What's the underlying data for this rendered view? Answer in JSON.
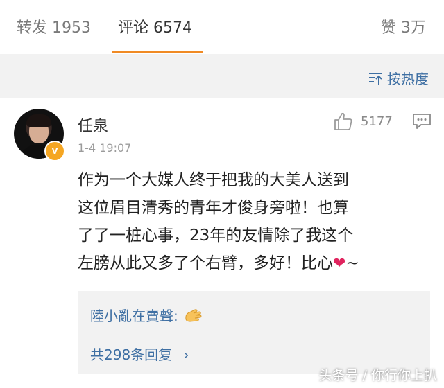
{
  "tabs": {
    "repost": "转发 1953",
    "comments": "评论 6574",
    "likes": "赞 3万"
  },
  "sort": {
    "label": "按热度"
  },
  "comment": {
    "username": "任泉",
    "timestamp": "1-4 19:07",
    "like_count": "5177",
    "lines": [
      "作为一个大媒人终于把我的大美人送到",
      "这位眉目清秀的青年才俊身旁啦！也算",
      "了了一桩心事，23年的友情除了我这个",
      "左膀从此又多了个右臂，多好！比心"
    ],
    "line_tail": "~",
    "verified_mark": "v"
  },
  "reply": {
    "author_text": "陸小亂在賣聲:",
    "more_label": "共298条回复",
    "more_chevron": "›"
  },
  "watermark": "头条号 / 你行你上扒",
  "icons": {
    "sort": "sort-icon",
    "like": "thumbs-up-icon",
    "reply": "comment-bubble-icon",
    "heart": "heart-emoji",
    "reply_emoji": "hand-emoji"
  },
  "colors": {
    "accent": "#f08a24",
    "link": "#3e6fa3",
    "verified": "#f5a623",
    "heart": "#e0245e"
  }
}
